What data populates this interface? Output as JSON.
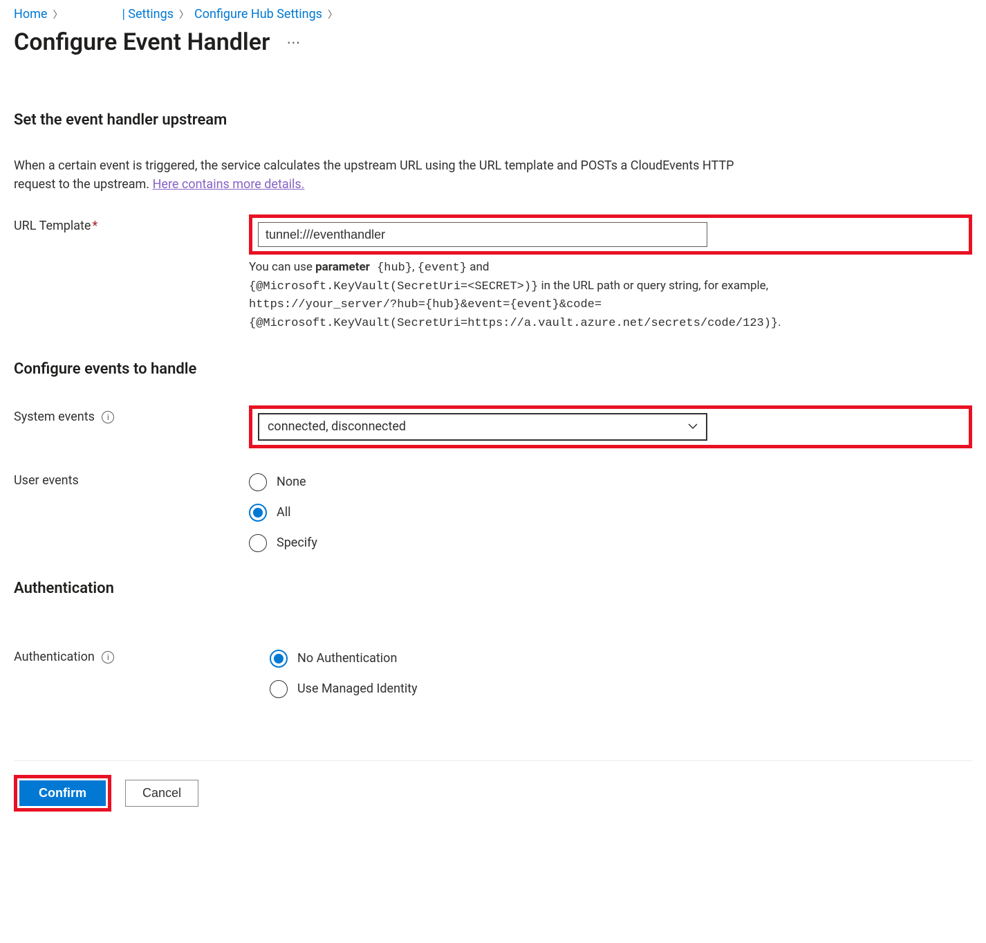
{
  "breadcrumb": {
    "home": "Home",
    "settings": "| Settings",
    "configure_hub": "Configure Hub Settings"
  },
  "page": {
    "title": "Configure Event Handler"
  },
  "upstream": {
    "heading": "Set the event handler upstream",
    "desc_pre": "When a certain event is triggered, the service calculates the upstream URL using the URL template and POSTs a CloudEvents HTTP request to the upstream. ",
    "desc_link": "Here contains more details.",
    "url_template_label": "URL Template",
    "url_template_value": "tunnel:///eventhandler",
    "help_line1_pre": "You can use ",
    "help_line1_bold": "parameter",
    "help_line1_mono1": " {hub}",
    "help_line1_mid": ", ",
    "help_line1_mono2": "{event}",
    "help_line1_post": " and",
    "help_line2_mono": "{@Microsoft.KeyVault(SecretUri=<SECRET>)}",
    "help_line2_post": " in the URL path or query string, for example, ",
    "help_line3_mono": "https://your_server/?hub={hub}&event={event}&code={@Microsoft.KeyVault(SecretUri=https://a.vault.azure.net/secrets/code/123)}",
    "help_line3_post": "."
  },
  "events": {
    "heading": "Configure events to handle",
    "system_label": "System events",
    "system_value": "connected, disconnected",
    "user_label": "User events",
    "options": {
      "none": "None",
      "all": "All",
      "specify": "Specify"
    }
  },
  "auth": {
    "heading": "Authentication",
    "label": "Authentication",
    "options": {
      "none": "No Authentication",
      "managed": "Use Managed Identity"
    }
  },
  "footer": {
    "confirm": "Confirm",
    "cancel": "Cancel"
  }
}
